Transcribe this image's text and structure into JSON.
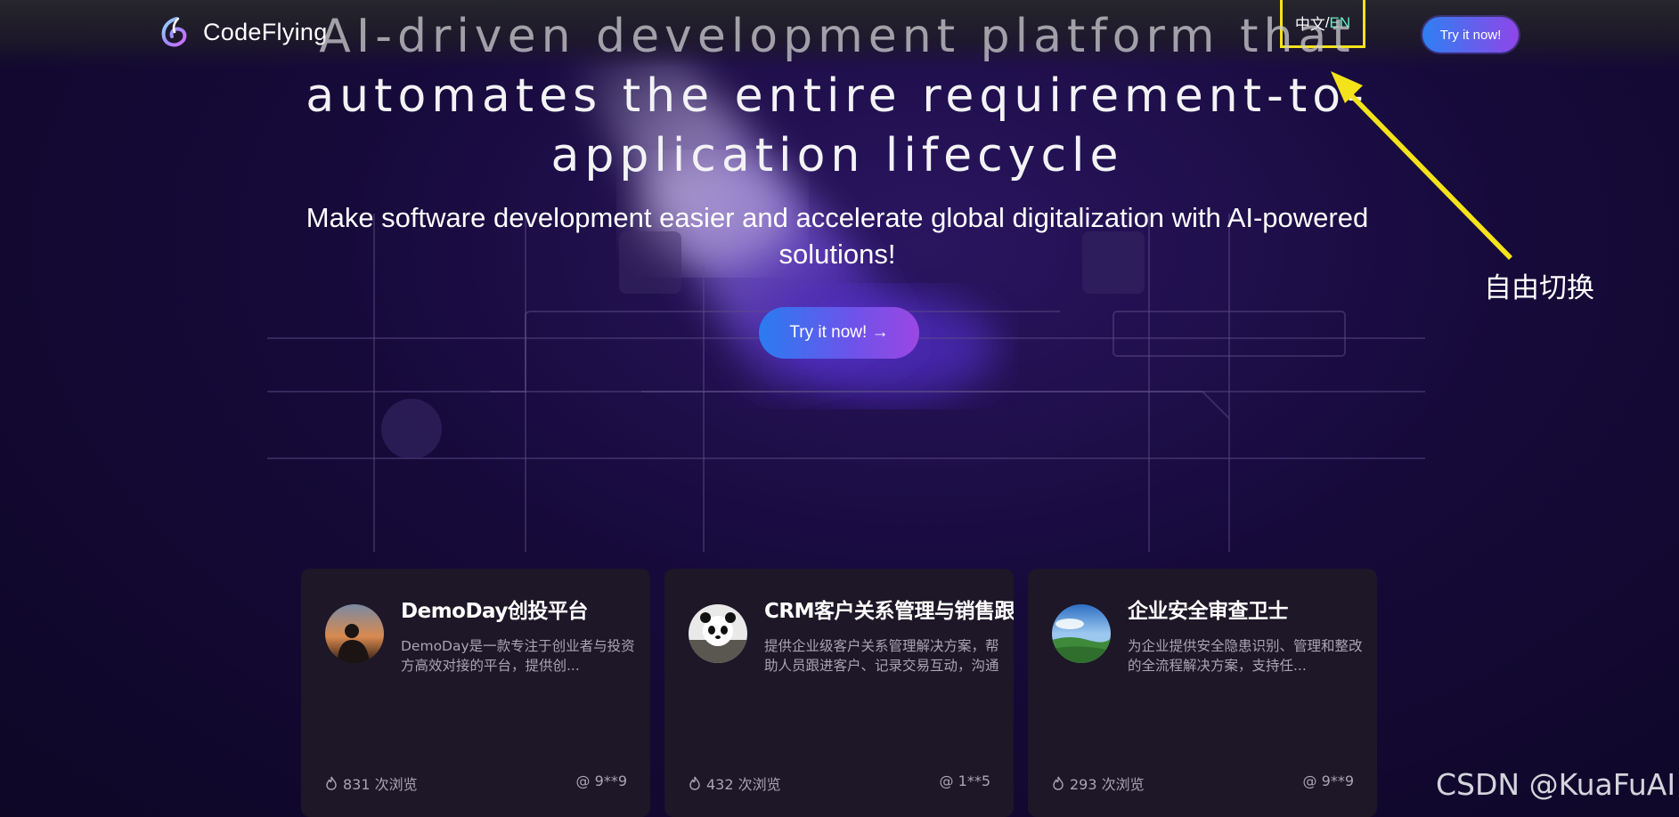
{
  "header": {
    "brand": "CodeFlying",
    "lang_zh": "中文",
    "lang_sep": "/",
    "lang_en": "EN",
    "cta_label": "Try it now!"
  },
  "hero": {
    "title_line1": "AI-driven development platform that",
    "title_line2": "automates the entire requirement-to-",
    "title_line3": "application lifecycle",
    "subtitle": "Make software development easier and accelerate global digitalization with AI-powered solutions!",
    "cta_label": "Try it now! →"
  },
  "annotation": {
    "label": "自由切换",
    "color": "#f4e31a"
  },
  "cards": [
    {
      "title": "DemoDay创投平台",
      "desc": "DemoDay是一款专注于创业者与投资方高效对接的平台，提供创...",
      "views": "831 次浏览",
      "author": "@ 9**9"
    },
    {
      "title": "CRM客户关系管理与销售跟踪",
      "desc": "提供企业级客户关系管理解决方案，帮助人员跟进客户、记录交易互动，沟通情况",
      "views": "432 次浏览",
      "author": "@ 1**5"
    },
    {
      "title": "企业安全审查卫士",
      "desc": "为企业提供安全隐患识别、管理和整改的全流程解决方案，支持任...",
      "views": "293 次浏览",
      "author": "@ 9**9"
    }
  ],
  "watermark": "CSDN @KuaFuAI",
  "colors": {
    "accent_gradient_start": "#2f7ff2",
    "accent_gradient_end": "#8f46e8",
    "lang_en_active": "#5ff0c8",
    "card_bg": "#1d1727"
  }
}
